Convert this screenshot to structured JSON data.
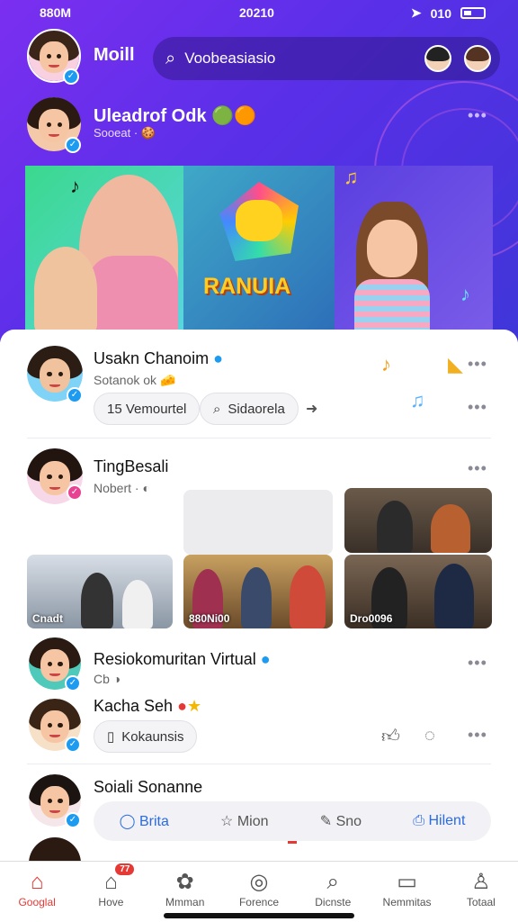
{
  "status": {
    "left": "880M",
    "time": "20210",
    "right": "010"
  },
  "header": {
    "user_name": "Moill",
    "search_placeholder": "Voobeasiasio"
  },
  "hero": {
    "title": "Uleadrof Odk",
    "subtitle": "Sooeat ·",
    "banner_text": "RANUIA"
  },
  "posts": [
    {
      "name": "Usakn Chanoim",
      "meta": "Sotanok ok",
      "chips": [
        "15 Vemourtel",
        "Sidaorela"
      ]
    },
    {
      "name": "TingBesali",
      "meta": "Nobert ·",
      "photo_captions": [
        "Cnadt",
        "880Ni00",
        "Dro0096"
      ]
    },
    {
      "name": "Resiokomuritan Virtual",
      "meta": "Cb"
    },
    {
      "name": "Kacha Seh",
      "chip": "Kokaunsis"
    },
    {
      "name": "Soiali Sonanne",
      "actions": [
        "Brita",
        "Mion",
        "Sno",
        "Hilent"
      ]
    }
  ],
  "nav": [
    {
      "label": "Googlal",
      "icon": "home-icon",
      "active": true
    },
    {
      "label": "Hove",
      "icon": "house-icon",
      "badge": "77"
    },
    {
      "label": "Mmman",
      "icon": "puzzle-icon"
    },
    {
      "label": "Forence",
      "icon": "search-icon"
    },
    {
      "label": "Dicnste",
      "icon": "explore-icon"
    },
    {
      "label": "Nemmitas",
      "icon": "message-icon"
    },
    {
      "label": "Totaal",
      "icon": "profile-icon"
    }
  ]
}
